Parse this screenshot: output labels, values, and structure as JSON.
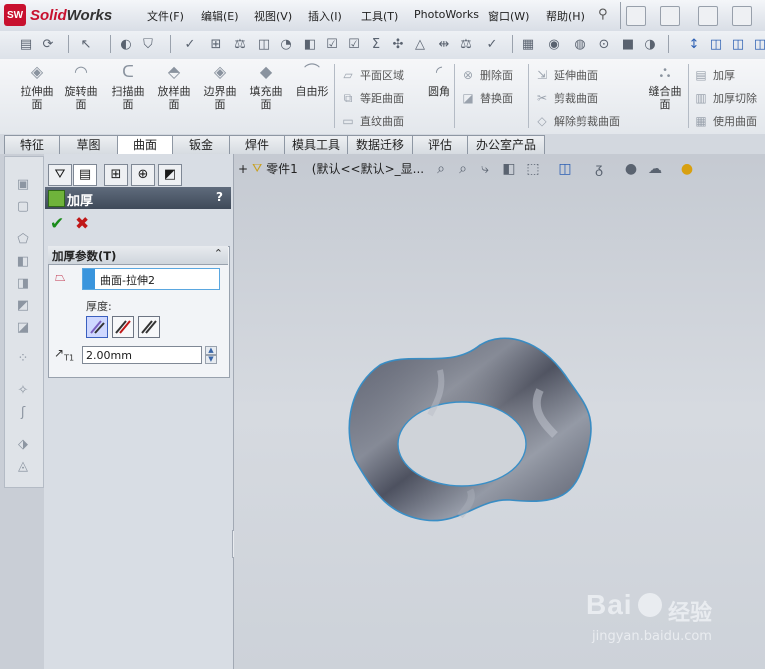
{
  "app": {
    "logo_badge": "SW",
    "logo_solid": "Solid",
    "logo_works": "Works",
    "brand_color": "#c8102e"
  },
  "menu": [
    "文件(F)",
    "编辑(E)",
    "视图(V)",
    "插入(I)",
    "工具(T)",
    "PhotoWorks",
    "窗口(W)",
    "帮助(H)"
  ],
  "commands": {
    "big": [
      "拉伸曲\n面",
      "旋转曲\n面",
      "扫描曲\n面",
      "放样曲\n面",
      "边界曲\n面",
      "填充曲\n面",
      "自由形"
    ],
    "col1": [
      "平面区域",
      "等距曲面",
      "直纹曲面"
    ],
    "fillet": "圆角",
    "col2": [
      "删除面",
      "替换面"
    ],
    "col3": [
      "延伸曲面",
      "剪裁曲面",
      "解除剪裁曲面"
    ],
    "knit": "缝合曲\n面",
    "col4": [
      "加厚",
      "加厚切除",
      "使用曲面"
    ]
  },
  "tabs": [
    "特征",
    "草图",
    "曲面",
    "钣金",
    "焊件",
    "模具工具",
    "数据迁移",
    "评估",
    "办公室产品"
  ],
  "active_tab": "曲面",
  "property_manager": {
    "title": "加厚",
    "help": "?",
    "ok": "✔",
    "cancel": "✖",
    "group_title": "加厚参数(T)",
    "collapse": "⌃",
    "surface": "曲面-拉伸2",
    "thickness_label": "厚度:",
    "thickness_value": "2.00mm",
    "thickness_unit_icon": "T1"
  },
  "tree": {
    "expand": "+",
    "part": "零件1",
    "config": "(默认<<默认>_显..."
  },
  "watermark": {
    "text1": "Bai",
    "text2": "经验",
    "url": "jingyan.baidu.com"
  },
  "icons": [
    "search-icon",
    "zoom-icon",
    "rotate-icon",
    "view-orientation-icon",
    "display-style-icon",
    "hide-show-icon",
    "appearance-icon",
    "scene-icon"
  ]
}
